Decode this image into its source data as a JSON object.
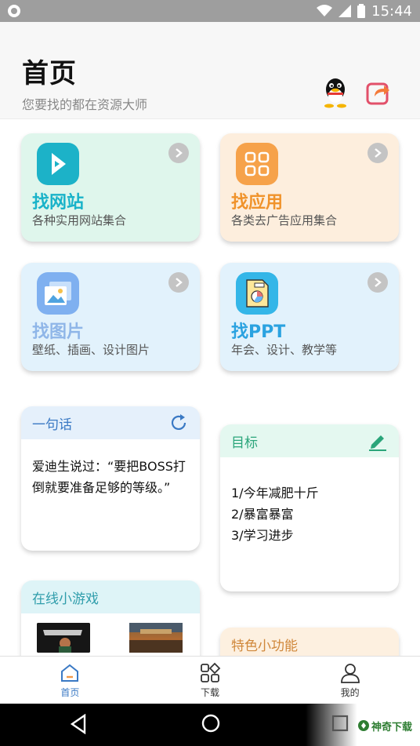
{
  "status_bar": {
    "time": "15:44",
    "icons": [
      "app-icon",
      "wifi-icon",
      "signal-icon",
      "battery-icon"
    ]
  },
  "header": {
    "title": "首页",
    "subtitle": "您要找的都在资源大师",
    "actions": [
      "qq-icon",
      "share-icon"
    ]
  },
  "features": [
    {
      "title": "找网站",
      "desc": "各种实用网站集合",
      "icon": "arrow-chevron-icon",
      "title_color": "#1ab3c9"
    },
    {
      "title": "找应用",
      "desc": "各类去广告应用集合",
      "icon": "grid-apps-icon",
      "title_color": "#f0932b"
    },
    {
      "title": "找图片",
      "desc": "壁纸、插画、设计图片",
      "icon": "image-icon",
      "title_color": "#8fb6e8"
    },
    {
      "title": "找PPT",
      "desc": "年会、设计、教学等",
      "icon": "ppt-file-icon",
      "title_color": "#2aa2e0"
    }
  ],
  "quote": {
    "heading": "一句话",
    "text": "爱迪生说过：“要把BOSS打倒就要准备足够的等级。”"
  },
  "goal": {
    "heading": "目标",
    "items": [
      "1/今年减肥十斤",
      "2/暴富暴富",
      "3/学习进步"
    ]
  },
  "games": {
    "heading": "在线小游戏"
  },
  "special": {
    "heading": "特色小功能"
  },
  "bottom_nav": [
    {
      "label": "首页",
      "icon": "home-icon",
      "active": true
    },
    {
      "label": "下载",
      "icon": "grid-icon",
      "active": false
    },
    {
      "label": "我的",
      "icon": "user-icon",
      "active": false
    }
  ],
  "watermark": {
    "text": "神奇下载"
  }
}
